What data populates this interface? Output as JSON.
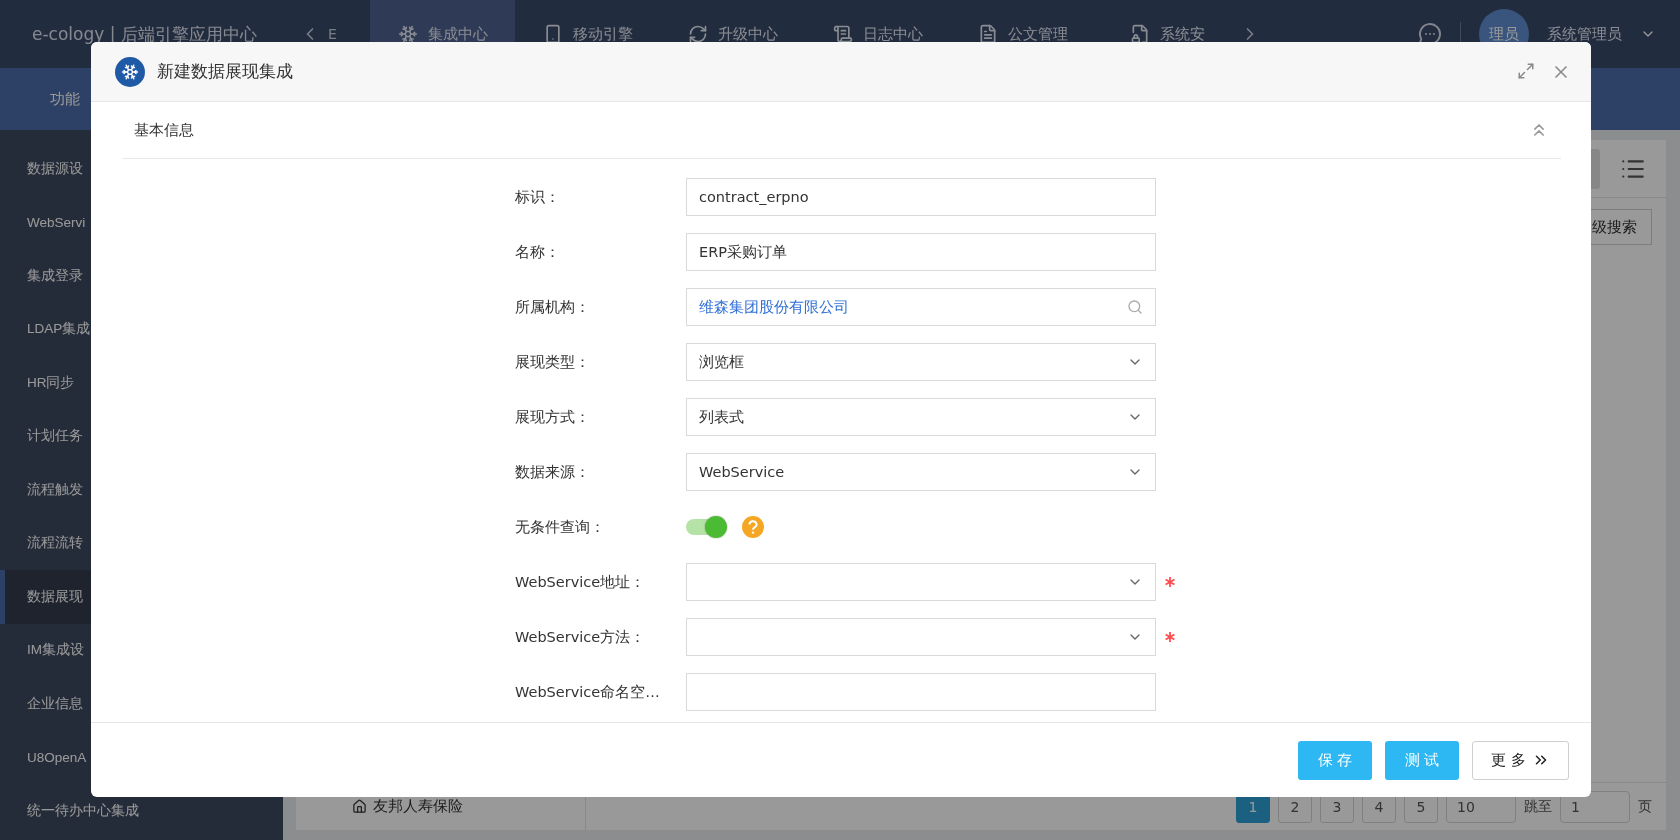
{
  "app": {
    "title": "e-cology | 后端引擎应用中心",
    "nav_partial": "E",
    "nav_tabs": [
      {
        "label": "集成中心",
        "selected": true
      },
      {
        "label": "移动引擎",
        "selected": false
      },
      {
        "label": "升级中心",
        "selected": false
      },
      {
        "label": "日志中心",
        "selected": false
      },
      {
        "label": "公文管理",
        "selected": false
      },
      {
        "label": "系统安",
        "selected": false
      }
    ],
    "user": {
      "avatar": "理员",
      "name": "系统管理员"
    }
  },
  "subbar": {
    "label": "功能"
  },
  "sidebar": {
    "items": [
      {
        "label": "数据源设",
        "selected": false
      },
      {
        "label": "WebServi",
        "selected": false
      },
      {
        "label": "集成登录",
        "selected": false
      },
      {
        "label": "LDAP集成",
        "selected": false
      },
      {
        "label": "HR同步",
        "selected": false
      },
      {
        "label": "计划任务",
        "selected": false
      },
      {
        "label": "流程触发",
        "selected": false
      },
      {
        "label": "流程流转",
        "selected": false
      },
      {
        "label": "数据展现",
        "selected": true
      },
      {
        "label": "IM集成设",
        "selected": false
      },
      {
        "label": "企业信息",
        "selected": false
      },
      {
        "label": "U8OpenA",
        "selected": false
      },
      {
        "label": "统一待办中心集成",
        "selected": false
      }
    ]
  },
  "content": {
    "search_button": "级搜索",
    "list_item": "友邦人寿保险",
    "pagination": {
      "pages": [
        {
          "label": "1",
          "selected": true
        },
        {
          "label": "2",
          "selected": false
        },
        {
          "label": "3",
          "selected": false
        },
        {
          "label": "4",
          "selected": false
        },
        {
          "label": "5",
          "selected": false
        }
      ],
      "page_size": "10",
      "jump_label": "跳至",
      "jump_value": "1",
      "page_unit": "页"
    }
  },
  "dialog": {
    "title": "新建数据展现集成",
    "section": {
      "title": "基本信息",
      "expanded": true
    },
    "fields": [
      {
        "kind": "text",
        "label": "标识：",
        "value": "contract_erpno",
        "required": false
      },
      {
        "kind": "text",
        "label": "名称：",
        "value": "ERP采购订单",
        "required": false
      },
      {
        "kind": "browse",
        "label": "所属机构：",
        "value": "维森集团股份有限公司",
        "required": false
      },
      {
        "kind": "select",
        "label": "展现类型：",
        "value": "浏览框",
        "required": false
      },
      {
        "kind": "select",
        "label": "展现方式：",
        "value": "列表式",
        "required": false
      },
      {
        "kind": "select",
        "label": "数据来源：",
        "value": "WebService",
        "required": false
      },
      {
        "kind": "switch",
        "label": "无条件查询：",
        "on": true,
        "required": false
      },
      {
        "kind": "select",
        "label": "WebService地址：",
        "required": true
      },
      {
        "kind": "select",
        "label": "WebService方法：",
        "required": true
      },
      {
        "kind": "text",
        "label": "WebService命名空…",
        "required": false
      }
    ],
    "buttons": [
      {
        "label": "保 存",
        "kind": "primary"
      },
      {
        "label": "测 试",
        "kind": "primary"
      },
      {
        "label": "更 多",
        "kind": "more"
      }
    ]
  }
}
